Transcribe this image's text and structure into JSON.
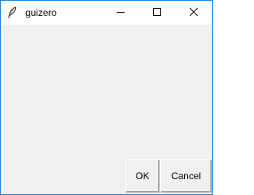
{
  "window": {
    "title": "guizero",
    "app_icon": "feather-icon",
    "controls": [
      "minimize-icon",
      "maximize-icon",
      "close-icon"
    ]
  },
  "buttons": {
    "ok_label": "OK",
    "cancel_label": "Cancel"
  },
  "colors": {
    "accent_border": "#1883d7",
    "client_background": "#f0f0f0",
    "titlebar_background": "#ffffff"
  }
}
